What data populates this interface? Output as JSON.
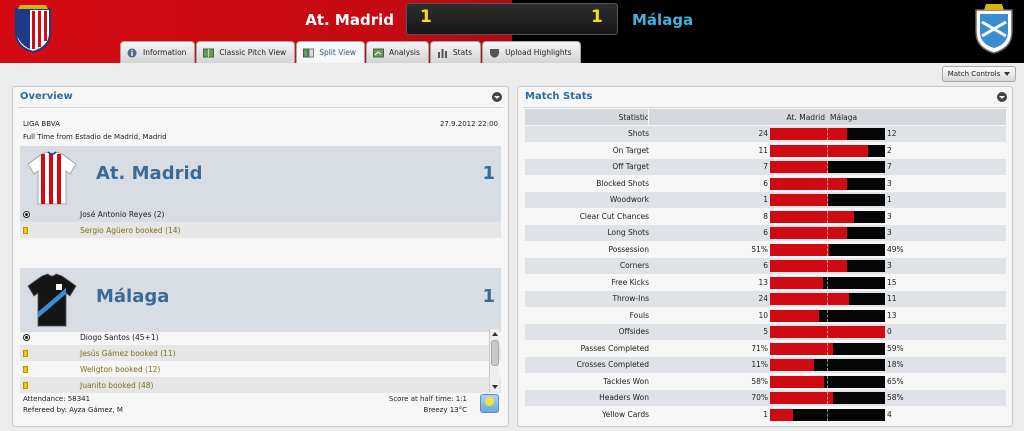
{
  "header": {
    "home_team": "At. Madrid",
    "away_team": "Málaga",
    "home_score": "1",
    "away_score": "1",
    "home_color": "#d40a12",
    "away_color": "#000000",
    "away_name_color": "#3fb3d9",
    "score_color": "#f3e10a"
  },
  "tabs": [
    {
      "label": "Information",
      "icon": "info-icon",
      "active": false
    },
    {
      "label": "Classic Pitch View",
      "icon": "pitch-icon",
      "active": false
    },
    {
      "label": "Split View",
      "icon": "split-view-icon",
      "active": true
    },
    {
      "label": "Analysis",
      "icon": "analysis-icon",
      "active": false
    },
    {
      "label": "Stats",
      "icon": "stats-icon",
      "active": false
    },
    {
      "label": "Upload Highlights",
      "icon": "shield-icon",
      "active": false
    }
  ],
  "toolbar": {
    "match_controls": "Match Controls"
  },
  "overview": {
    "title": "Overview",
    "competition": "LIGA BBVA",
    "date": "27.9.2012 22:00",
    "venue": "Full Time from Estadio de Madrid, Madrid",
    "home": {
      "name": "At. Madrid",
      "goals": "1",
      "events": [
        {
          "type": "goal",
          "text": "José Antonio Reyes (2)"
        },
        {
          "type": "booking",
          "text": "Sergio Agüero booked (14)"
        }
      ]
    },
    "away": {
      "name": "Málaga",
      "goals": "1",
      "events": [
        {
          "type": "goal",
          "text": "Diogo Santos (45+1)"
        },
        {
          "type": "booking",
          "text": "Jesús Gámez booked (11)"
        },
        {
          "type": "booking",
          "text": "Weligton booked (12)"
        },
        {
          "type": "booking",
          "text": "Juanito booked (48)"
        }
      ]
    },
    "attendance": "Attendance: 58341",
    "referee": "Refereed by: Ayza Gámez, M",
    "half_time": "Score at half time: 1:1",
    "weather": "Breezy 13°C"
  },
  "match_stats": {
    "title": "Match Stats",
    "columns": {
      "statistic": "Statistic",
      "home": "At. Madrid",
      "away": "Málaga"
    },
    "home_bar_color": "#d00a12",
    "away_bar_color": "#050505",
    "rows": [
      {
        "stat": "Shots",
        "home": "24",
        "away": "12",
        "share": 0.67
      },
      {
        "stat": "On Target",
        "home": "11",
        "away": "2",
        "share": 0.85
      },
      {
        "stat": "Off Target",
        "home": "7",
        "away": "7",
        "share": 0.5
      },
      {
        "stat": "Blocked Shots",
        "home": "6",
        "away": "3",
        "share": 0.67
      },
      {
        "stat": "Woodwork",
        "home": "1",
        "away": "1",
        "share": 0.5
      },
      {
        "stat": "Clear Cut Chances",
        "home": "8",
        "away": "3",
        "share": 0.73
      },
      {
        "stat": "Long Shots",
        "home": "6",
        "away": "3",
        "share": 0.67
      },
      {
        "stat": "Possession",
        "home": "51%",
        "away": "49%",
        "share": 0.51
      },
      {
        "stat": "Corners",
        "home": "6",
        "away": "3",
        "share": 0.67
      },
      {
        "stat": "Free Kicks",
        "home": "13",
        "away": "15",
        "share": 0.46
      },
      {
        "stat": "Throw-Ins",
        "home": "24",
        "away": "11",
        "share": 0.69
      },
      {
        "stat": "Fouls",
        "home": "10",
        "away": "13",
        "share": 0.43
      },
      {
        "stat": "Offsides",
        "home": "5",
        "away": "0",
        "share": 1.0
      },
      {
        "stat": "Passes Completed",
        "home": "71%",
        "away": "59%",
        "share": 0.55
      },
      {
        "stat": "Crosses Completed",
        "home": "11%",
        "away": "18%",
        "share": 0.38
      },
      {
        "stat": "Tackles Won",
        "home": "58%",
        "away": "65%",
        "share": 0.47
      },
      {
        "stat": "Headers Won",
        "home": "70%",
        "away": "58%",
        "share": 0.55
      },
      {
        "stat": "Yellow Cards",
        "home": "1",
        "away": "4",
        "share": 0.2
      }
    ]
  }
}
